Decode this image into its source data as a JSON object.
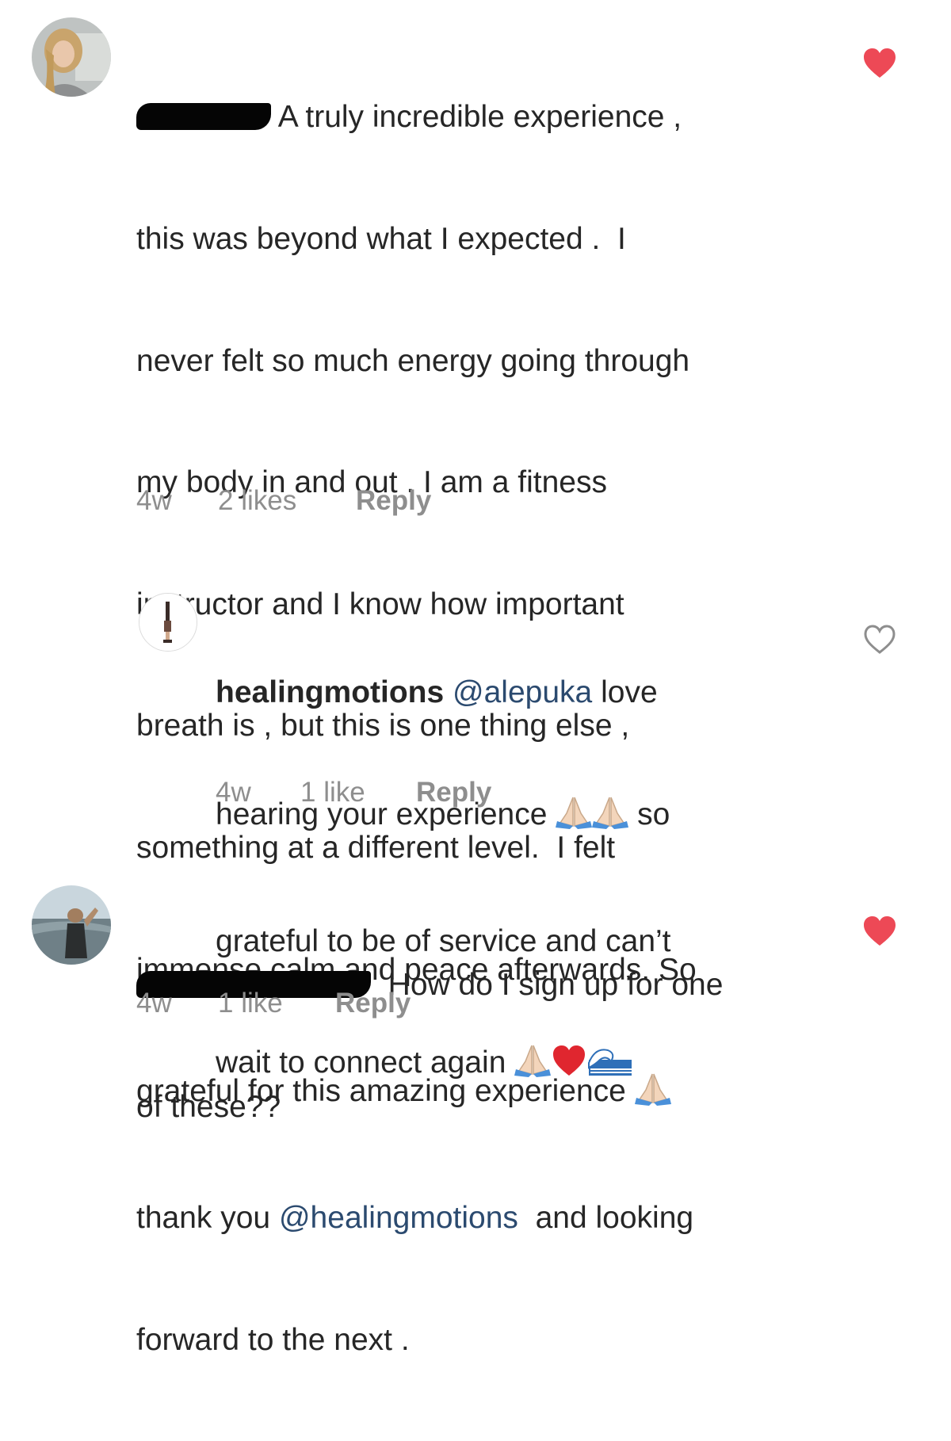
{
  "comments": [
    {
      "lines": [
        "A truly incredible experience ,",
        "this was beyond what I expected .  I",
        "never felt so much energy going through",
        "my body in and out . I am a fitness",
        "instructor and I know how important",
        "breath is , but this is one thing else ,",
        "something at a different level.  I felt",
        "immense calm and peace afterwards. So",
        "grateful for this amazing experience",
        "thank you",
        "@healingmotions",
        "and looking",
        "forward to the next ."
      ],
      "time": "4w",
      "likes": "2 likes",
      "reply": "Reply",
      "liked": true,
      "heart_color": "#ed4956"
    },
    {
      "username": "healingmotions",
      "mention": "@alepuka",
      "lines": [
        "love",
        "hearing your experience",
        "so",
        "grateful to be of service and can’t",
        "wait to connect again"
      ],
      "time": "4w",
      "likes": "1 like",
      "reply": "Reply",
      "liked": false
    },
    {
      "lines": [
        "How do I sign up for one",
        "of these??"
      ],
      "time": "4w",
      "likes": "1 like",
      "reply": "Reply",
      "liked": true,
      "heart_color": "#ed4956"
    }
  ],
  "icons": {
    "liked": "heart-filled-icon",
    "unliked": "heart-outline-icon",
    "pray": "folded-hands-emoji",
    "red_heart": "red-heart-emoji",
    "wave": "water-wave-emoji"
  }
}
